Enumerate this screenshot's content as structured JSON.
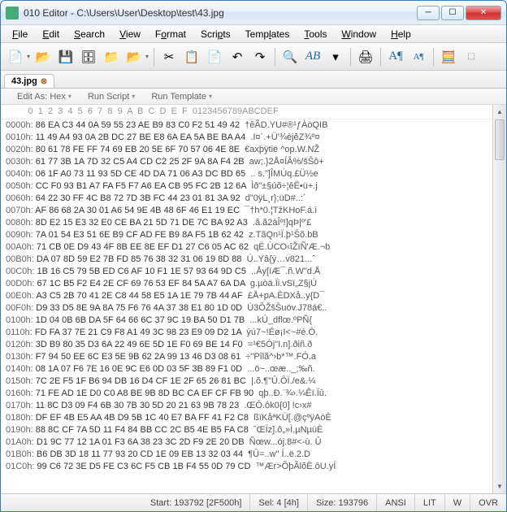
{
  "title": "010 Editor - C:\\Users\\User\\Desktop\\test\\43.jpg",
  "menus": [
    "File",
    "Edit",
    "Search",
    "View",
    "Format",
    "Scripts",
    "Templates",
    "Tools",
    "Window",
    "Help"
  ],
  "tab": {
    "label": "43.jpg"
  },
  "subtoolbar": {
    "edit_as": "Edit As: Hex",
    "run_script": "Run Script",
    "run_template": "Run Template"
  },
  "hex_header": "         0  1  2  3  4  5  6  7  8  9  A  B  C  D  E  F  0123456789ABCDEF",
  "rows": [
    {
      "addr": "0000h:",
      "hex": " 86 EA C3 44 0A 59 55 23 AE B9 83 C0 F2 51 49 42",
      "ascii": " †êÃD.YU#®¹ƒÀòQIB"
    },
    {
      "addr": "0010h:",
      "hex": " 11 49 A4 93 0A 2B DC 27 BE E8 6A EA 5A BE BA A4",
      "ascii": " .I¤´.+Ü'¾èjêZ¾º¤"
    },
    {
      "addr": "0020h:",
      "hex": " 80 61 78 FE FF 74 69 EB 20 5E 6F 70 57 06 4E 8E",
      "ascii": " €axþÿtië ^op.W.NŽ"
    },
    {
      "addr": "0030h:",
      "hex": " 61 77 3B 1A 7D 32 C5 A4 CD C2 25 2F 9A 8A F4 2B",
      "ascii": " aw;.}2Å¤ÍÂ%/šŠô+"
    },
    {
      "addr": "0040h:",
      "hex": " 06 1F A0 73 11 93 5D CE 4D DA 71 06 A3 DC BD 65",
      "ascii": " .. s.\"]ÎMÚq.£Ü½e"
    },
    {
      "addr": "0050h:",
      "hex": " CC F0 93 B1 A7 FA F5 F7 A6 EA CB 95 FC 2B 12 6A",
      "ascii": " Ìð\"±§úõ÷¦êË•ü+.j"
    },
    {
      "addr": "0060h:",
      "hex": " 64 22 30 FF 4C B8 72 7D 3B FC 44 23 01 81 3A 92",
      "ascii": " d\"0ÿL¸r};üD#..:´"
    },
    {
      "addr": "0070h:",
      "hex": " AF 86 68 2A 30 01 A6 54 9E 4B 48 6F 46 E1 19 EC",
      "ascii": " ¯†h*0.¦TžKHoF.á.ì"
    },
    {
      "addr": "0080h:",
      "hex": " 8D E2 15 E3 32 E0 CE BA 21 5D 71 DE 7C BA 92 A3",
      "ascii": " .â.ã2àÎº!]qÞ|º'£"
    },
    {
      "addr": "0090h:",
      "hex": " 7A 01 54 E3 51 6E B9 CF AD FE B9 8A F5 1B 62 42",
      "ascii": " z.TãQn¹Ï.þ¹Šõ.bB"
    },
    {
      "addr": "00A0h:",
      "hex": " 71 CB 0E D9 43 4F 8B EE 8E EF D1 27 C6 05 AC 62",
      "ascii": " qË.ÙCO‹îŽïÑ'Æ.¬b"
    },
    {
      "addr": "00B0h:",
      "hex": " DA 07 8D 59 E2 7B FD 85 76 38 32 31 06 19 8D 88",
      "ascii": " Ú..Yâ{ý…v821...ˆ"
    },
    {
      "addr": "00C0h:",
      "hex": " 1B 16 C5 79 5B ED C6 AF 10 F1 1E 57 93 64 9D C5",
      "ascii": " ..Åy[íÆ¯.ñ.W\"d.Å"
    },
    {
      "addr": "00D0h:",
      "hex": " 67 1C B5 F2 E4 2E CF 69 76 53 EF 84 5A A7 6A DA",
      "ascii": " g.µòä.Ïi.vSï„Z§jÚ"
    },
    {
      "addr": "00E0h:",
      "hex": " A3 C5 2B 70 41 2E C8 44 58 E5 1A 1E 79 7B 44 AF",
      "ascii": " £Å+pA.ÈDXå..y{D¯"
    },
    {
      "addr": "00F0h:",
      "hex": " D9 33 D5 8E 9A 8A 75 F6 76 4A 37 38 E1 80 1D 0D",
      "ascii": " Ù3ÕŽšŠuöv.J78á€.."
    },
    {
      "addr": "0100h:",
      "hex": " 1D 04 0B 6B DA 5F 64 66 6C 37 9C 19 BA 50 D1 7B",
      "ascii": " ...kÚ_dflœ.ºPÑ{"
    },
    {
      "addr": "0110h:",
      "hex": " FD FA 37 7E 21 C9 F8 A1 49 3C 98 23 E9 09 D2 1A",
      "ascii": " ýú7~!Éø¡I<~#é.Ò."
    },
    {
      "addr": "0120h:",
      "hex": " 3D B9 80 35 D3 6A 22 49 6E 5D 1E F0 69 BE 14 F0",
      "ascii": " =¹€5Ój\"I.n].ðiñ.ð"
    },
    {
      "addr": "0130h:",
      "hex": " F7 94 50 EE 6C E3 5E 9B 62 2A 99 13 46 D3 08 61",
      "ascii": " ÷\"Pîlã^›b*™.FÓ.a"
    },
    {
      "addr": "0140h:",
      "hex": " 08 1A 07 F6 7E 16 0E 9C E6 0D 03 5F 3B 89 F1 0D",
      "ascii": " ...ö~..œæ.._;‰ñ."
    },
    {
      "addr": "0150h:",
      "hex": " 7C 2E F5 1F B6 94 DB 16 D4 CF 1E 2F 65 26 81 BC",
      "ascii": " |.õ.¶\"Û.ÔÏ./e&.¼"
    },
    {
      "addr": "0160h:",
      "hex": " 71 FE AD 1E D0 C0 A8 BE 9B 8D BC CA EF CF FB 90",
      "ascii": " qþ..Ð.¨¾›.¼Êï.Ïû."
    },
    {
      "addr": "0170h:",
      "hex": " 11 8C D3 09 F4 6B 30 7B 30 5D 20 21 63 9B 78 23",
      "ascii": " .ŒÓ.ôk0{0] !c›x#"
    },
    {
      "addr": "0180h:",
      "hex": " DF EF 4B E5 AA 4B D9 5B 1C 40 E7 BA FF 41 F2 C8",
      "ascii": " ßïKåªKÙ[.@çºÿAòÈ"
    },
    {
      "addr": "0190h:",
      "hex": " 88 8C CF 7A 5D 11 F4 84 BB CC 2C B5 4E B5 FA C8",
      "ascii": " ˆŒÏz].ô„»Ì,µNµúÈ"
    },
    {
      "addr": "01A0h:",
      "hex": " D1 9C 77 12 1A 01 F3 6A 38 23 3C 2D F9 2E 20 DB",
      "ascii": " Ñœw...ój.8#<-ù. Û"
    },
    {
      "addr": "01B0h:",
      "hex": " B6 DB 3D 18 11 77 93 20 CD 1E 09 EB 13 32 03 44",
      "ascii": " ¶Û=..w\" Í..ë.2.D"
    },
    {
      "addr": "01C0h:",
      "hex": " 99 C6 72 3E D5 FE C3 6C F5 CB 1B F4 55 0D 79 CD",
      "ascii": " ™Ær>ÕþÃlõË.ôU.yÍ"
    }
  ],
  "status": {
    "start": "Start: 193792 [2F500h]",
    "sel": "Sel: 4 [4h]",
    "size": "Size: 193796",
    "charset": "ANSI",
    "endian": "LIT",
    "mode1": "W",
    "mode2": "OVR"
  },
  "toolbar_icons": [
    "new",
    "open",
    "save",
    "saveall",
    "open2",
    "open3",
    "cut",
    "copy",
    "paste",
    "undo",
    "redo",
    "find",
    "findtext",
    "down",
    "print",
    "fontA",
    "fontA2",
    "calc",
    "hex"
  ],
  "colors": {
    "accent": "#3a7ab8"
  }
}
